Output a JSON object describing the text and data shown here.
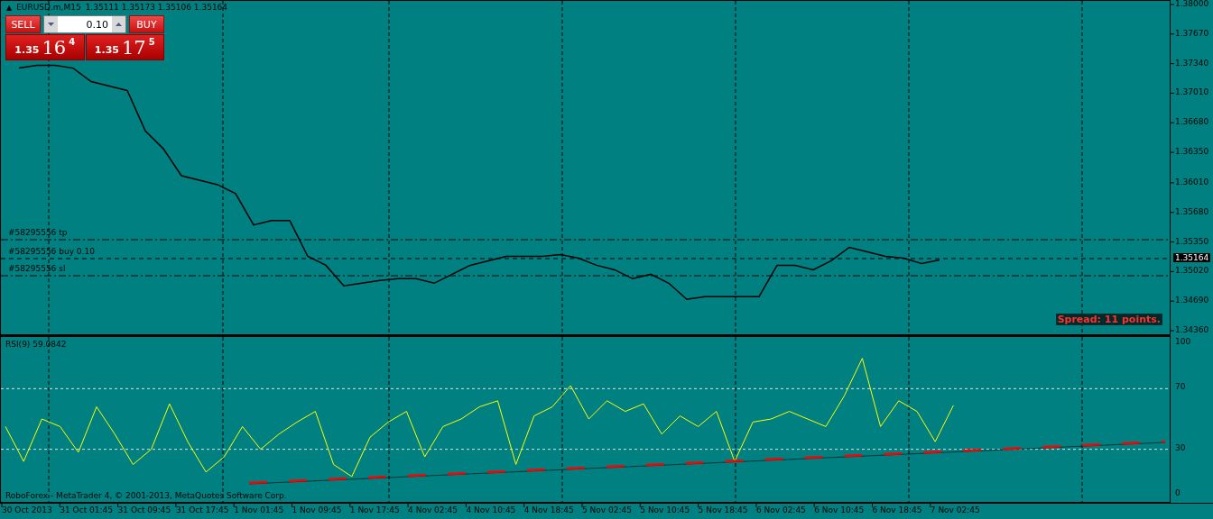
{
  "chart_header": {
    "collapse_icon": "▲",
    "symbol": "EURUSD.m,M15",
    "ohlc": "1.35111 1.35173 1.35106 1.35164"
  },
  "trade_panel": {
    "sell_label": "SELL",
    "buy_label": "BUY",
    "volume": "0.10",
    "bid": {
      "prefix": "1.35",
      "pips": "16",
      "point": "4"
    },
    "ask": {
      "prefix": "1.35",
      "pips": "17",
      "point": "5"
    }
  },
  "orders": [
    {
      "kind": "tp",
      "label": "#58295556 tp"
    },
    {
      "kind": "open",
      "label": "#58295556 buy 0.10"
    },
    {
      "kind": "sl",
      "label": "#58295556 sl"
    }
  ],
  "spread": "Spread: 11 points.",
  "current_price": "1.35164",
  "time_axis": [
    "30 Oct 2013",
    "31 Oct 01:45",
    "31 Oct 09:45",
    "31 Oct 17:45",
    "1 Nov 01:45",
    "1 Nov 09:45",
    "1 Nov 17:45",
    "4 Nov 02:45",
    "4 Nov 10:45",
    "4 Nov 18:45",
    "5 Nov 02:45",
    "5 Nov 10:45",
    "5 Nov 18:45",
    "6 Nov 02:45",
    "6 Nov 10:45",
    "6 Nov 18:45",
    "7 Nov 02:45"
  ],
  "price_chart": {
    "chart_data": {
      "type": "line",
      "grid": true,
      "ylim": [
        1.3433,
        1.3805
      ],
      "yticks": [
        {
          "value": 1.38,
          "label": "1.38000"
        },
        {
          "value": 1.3767,
          "label": "1.37670"
        },
        {
          "value": 1.3734,
          "label": "1.37340"
        },
        {
          "value": 1.3701,
          "label": "1.37010"
        },
        {
          "value": 1.3668,
          "label": "1.36680"
        },
        {
          "value": 1.3635,
          "label": "1.36350"
        },
        {
          "value": 1.3601,
          "label": "1.36010"
        },
        {
          "value": 1.3568,
          "label": "1.35680"
        },
        {
          "value": 1.3535,
          "label": "1.35350"
        },
        {
          "value": 1.3502,
          "label": "1.35020"
        },
        {
          "value": 1.3469,
          "label": "1.34690"
        },
        {
          "value": 1.3436,
          "label": "1.34360"
        }
      ],
      "series": [
        {
          "color": "#000000",
          "values": [
            1.373,
            1.3733,
            1.3733,
            1.373,
            1.3715,
            1.371,
            1.3705,
            1.366,
            1.364,
            1.361,
            1.3605,
            1.36,
            1.359,
            1.3555,
            1.356,
            1.356,
            1.352,
            1.351,
            1.3487,
            1.349,
            1.3493,
            1.3495,
            1.3495,
            1.349,
            1.35,
            1.351,
            1.3515,
            1.352,
            1.352,
            1.352,
            1.3522,
            1.3518,
            1.351,
            1.3505,
            1.3495,
            1.35,
            1.349,
            1.3472,
            1.3475,
            1.3475,
            1.3475,
            1.3475,
            1.351,
            1.351,
            1.3505,
            1.3515,
            1.353,
            1.3525,
            1.352,
            1.3518,
            1.3512,
            1.3516
          ]
        }
      ]
    }
  },
  "rsi_chart": {
    "chart_data": {
      "type": "line",
      "grid": true,
      "title": "RSI(9) 59.0842",
      "ylim": [
        -4.7,
        104.1
      ],
      "yticks": [
        {
          "value": 0,
          "label": "0"
        },
        {
          "value": 30,
          "label": "30"
        },
        {
          "value": 70,
          "label": "70"
        },
        {
          "value": 100,
          "label": "100"
        }
      ],
      "series": [
        {
          "color": "#ffff00",
          "values": [
            45,
            22,
            50,
            45,
            28,
            58,
            40,
            20,
            30,
            60,
            35,
            15,
            25,
            45,
            30,
            40,
            48,
            55,
            20,
            12,
            38,
            48,
            55,
            25,
            45,
            50,
            58,
            62,
            20,
            52,
            58,
            72,
            50,
            62,
            55,
            60,
            40,
            52,
            45,
            55,
            22,
            48,
            50,
            55,
            50,
            45,
            65,
            90,
            45,
            62,
            55,
            35,
            59
          ]
        }
      ]
    }
  },
  "copyright": "RoboForex - MetaTrader 4, © 2001-2013, MetaQuotes Software Corp."
}
